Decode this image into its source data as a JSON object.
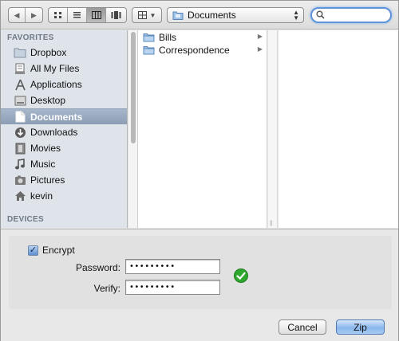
{
  "toolbar": {
    "back_icon": "triangle-left-icon",
    "forward_icon": "triangle-right-icon",
    "view_modes": [
      "icon-view-icon",
      "list-view-icon",
      "column-view-icon",
      "coverflow-view-icon"
    ],
    "active_view": "column-view-icon",
    "arrange_icon": "grid-arrange-icon",
    "path_label": "Documents",
    "search_value": ""
  },
  "sidebar": {
    "favorites_header": "FAVORITES",
    "devices_header": "DEVICES",
    "items": [
      {
        "label": "Dropbox",
        "icon": "folder-icon"
      },
      {
        "label": "All My Files",
        "icon": "all-files-icon"
      },
      {
        "label": "Applications",
        "icon": "applications-icon"
      },
      {
        "label": "Desktop",
        "icon": "desktop-icon"
      },
      {
        "label": "Documents",
        "icon": "documents-icon",
        "selected": true
      },
      {
        "label": "Downloads",
        "icon": "downloads-icon"
      },
      {
        "label": "Movies",
        "icon": "movies-icon"
      },
      {
        "label": "Music",
        "icon": "music-icon"
      },
      {
        "label": "Pictures",
        "icon": "pictures-icon"
      },
      {
        "label": "kevin",
        "icon": "home-icon"
      }
    ]
  },
  "browser": {
    "column1": [
      {
        "name": "Bills"
      },
      {
        "name": "Correspondence"
      }
    ]
  },
  "options": {
    "encrypt_label": "Encrypt",
    "encrypt_checked": true,
    "password_label": "Password:",
    "password_value": "•••••••••",
    "verify_label": "Verify:",
    "verify_value": "•••••••••"
  },
  "buttons": {
    "cancel": "Cancel",
    "zip": "Zip"
  },
  "colors": {
    "selection": "#8b9db5",
    "default_button": "#8ab6ec",
    "success": "#2fa82f",
    "focus_ring": "#5f95d8"
  }
}
